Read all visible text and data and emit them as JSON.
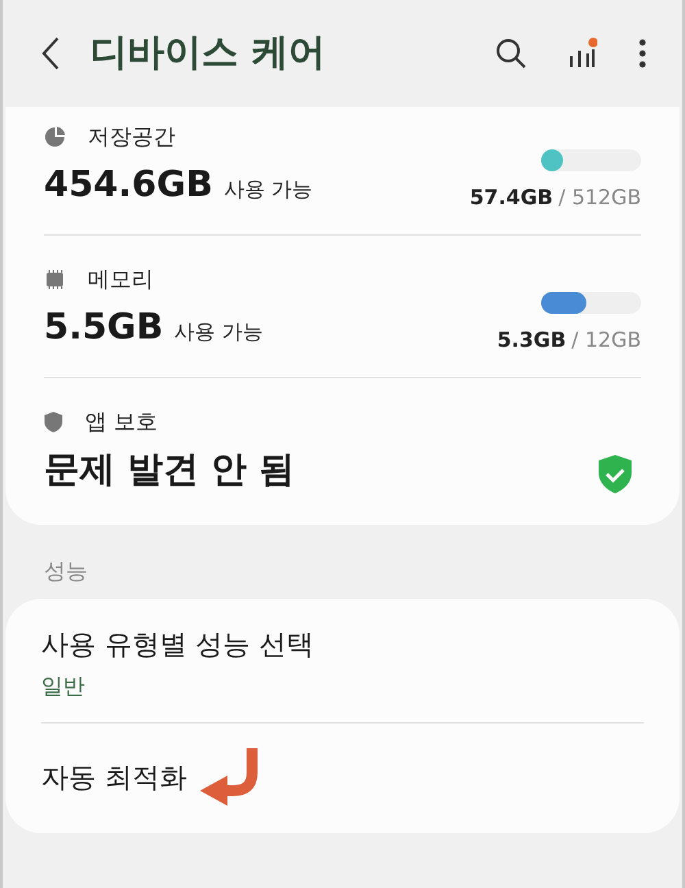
{
  "header": {
    "title": "디바이스 케어",
    "stats_dot": true
  },
  "status_items": [
    {
      "kind": "storage",
      "label": "저장공간",
      "value": "454.6GB",
      "value_suffix": "사용 가능",
      "level": 0.11,
      "color": "#4fc3c4",
      "used": "57.4GB",
      "total": "/ 512GB"
    },
    {
      "kind": "memory",
      "label": "메모리",
      "value": "5.5GB",
      "value_suffix": "사용 가능",
      "level": 0.45,
      "color": "#4a8bd6",
      "used": "5.3GB",
      "total": "/ 12GB"
    },
    {
      "kind": "protection",
      "label": "앱 보호",
      "value": "문제 발견 안 됨",
      "ok": true
    }
  ],
  "sections": [
    {
      "title": "성능",
      "items": [
        {
          "title": "사용 유형별 성능 선택",
          "subtitle": "일반"
        },
        {
          "title": "자동 최적화"
        }
      ]
    }
  ]
}
